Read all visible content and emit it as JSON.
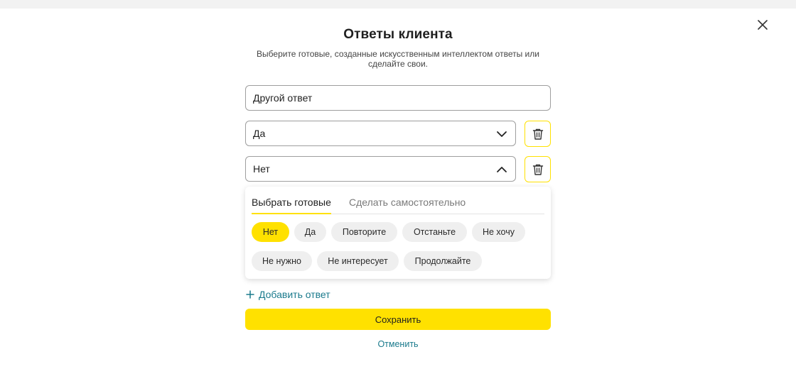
{
  "dialog": {
    "title": "Ответы клиента",
    "subtitle": "Выберите готовые, созданные искусственным интеллектом ответы или сделайте свои."
  },
  "answers": [
    {
      "value": "Другой ответ",
      "has_dropdown": false
    },
    {
      "value": "Да",
      "has_dropdown": true,
      "expanded": false
    },
    {
      "value": "Нет",
      "has_dropdown": true,
      "expanded": true
    }
  ],
  "panel": {
    "tabs": [
      {
        "label": "Выбрать готовые",
        "active": true
      },
      {
        "label": "Сделать самостоятельно",
        "active": false
      }
    ],
    "chips": [
      {
        "label": "Нет",
        "selected": true
      },
      {
        "label": "Да",
        "selected": false
      },
      {
        "label": "Повторите",
        "selected": false
      },
      {
        "label": "Отстаньте",
        "selected": false
      },
      {
        "label": "Не хочу",
        "selected": false
      },
      {
        "label": "Не нужно",
        "selected": false
      },
      {
        "label": "Не интересует",
        "selected": false
      },
      {
        "label": "Продолжайте",
        "selected": false
      }
    ]
  },
  "actions": {
    "add_label": "Добавить ответ",
    "save_label": "Сохранить",
    "cancel_label": "Отменить"
  },
  "icons": {
    "close": "close-icon",
    "trash": "trash-icon",
    "chevron_down": "chevron-down-icon",
    "chevron_up": "chevron-up-icon",
    "plus": "plus-icon"
  },
  "colors": {
    "accent": "#ffe100",
    "link": "#1a7a8c",
    "chip_bg": "#efefef",
    "field_border": "#9e9e9e"
  }
}
